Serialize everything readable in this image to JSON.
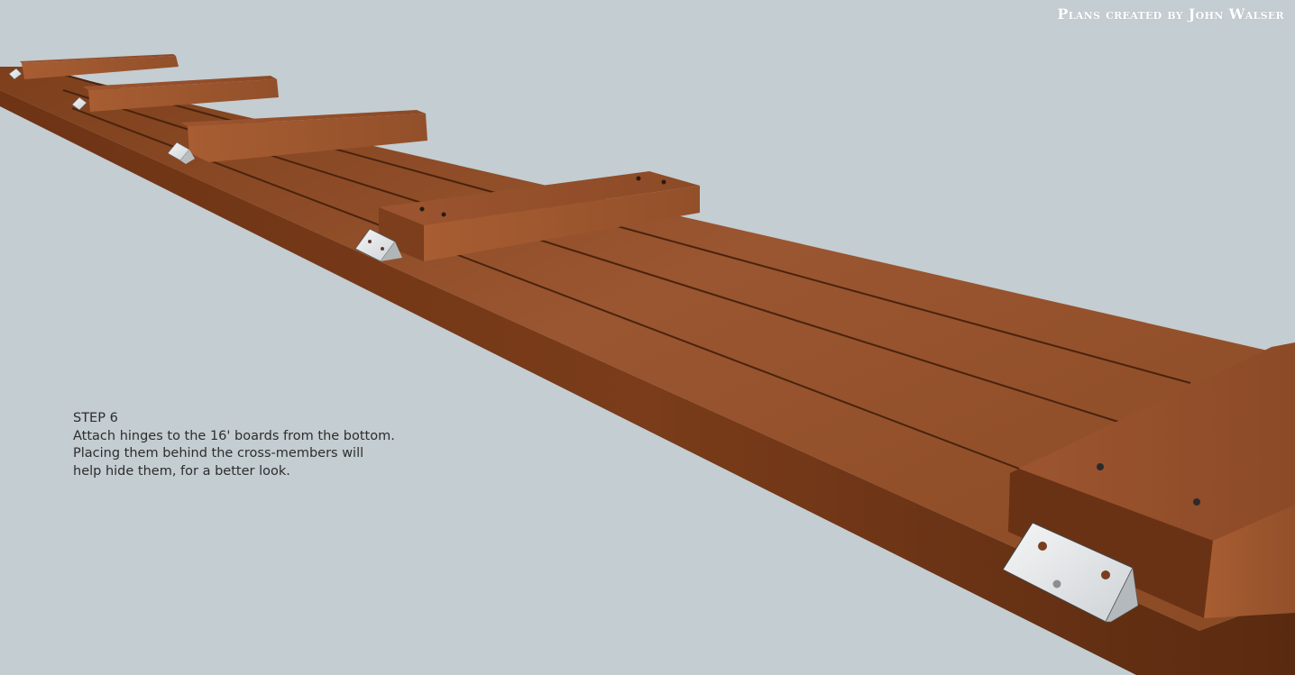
{
  "credit": "Plans created by John Walser",
  "step": {
    "title": "STEP 6",
    "lines": [
      "Attach hinges to the 16' boards from the bottom.",
      "Placing them behind the cross-members will",
      "help hide them, for a better look."
    ]
  },
  "colors": {
    "background": "#c4cdd1",
    "wood_top": "#8a4a22",
    "wood_side": "#5e2f12",
    "hinge": "#e6e8ea"
  }
}
